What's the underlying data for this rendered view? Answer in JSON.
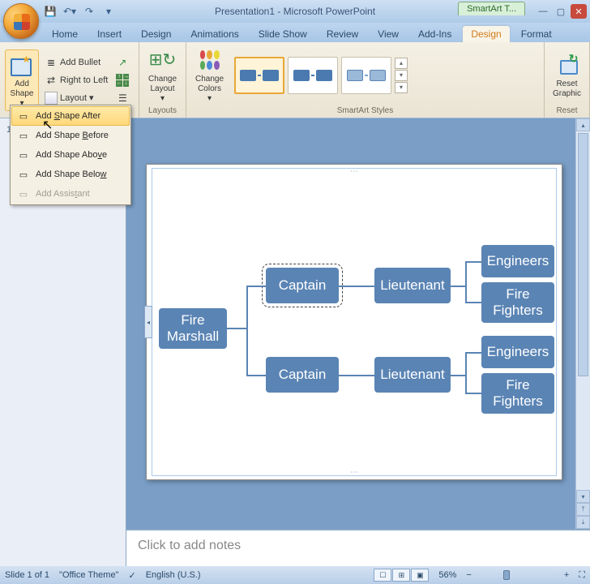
{
  "app_title": "Presentation1 - Microsoft PowerPoint",
  "contextual_tab": "SmartArt T...",
  "qat_icons": [
    "save-icon",
    "undo-icon",
    "redo-icon",
    "qat-more-icon"
  ],
  "tabs": {
    "items": [
      "Home",
      "Insert",
      "Design",
      "Animations",
      "Slide Show",
      "Review",
      "View",
      "Add-Ins",
      "Design",
      "Format"
    ],
    "active_index": 8
  },
  "ribbon": {
    "create_graphic": {
      "add_shape": "Add\nShape",
      "add_bullet": "Add Bullet",
      "right_to_left": "Right to Left",
      "layout": "Layout"
    },
    "layouts_label": "Layouts",
    "change_layout": "Change\nLayout",
    "change_colors": "Change\nColors",
    "styles_label": "SmartArt Styles",
    "reset_graphic": "Reset\nGraphic",
    "reset_label": "Reset"
  },
  "dropdown": {
    "items": [
      {
        "label_pre": "Add ",
        "ul": "S",
        "label_post": "hape After",
        "hover": true
      },
      {
        "label_pre": "Add Shape ",
        "ul": "B",
        "label_post": "efore"
      },
      {
        "label_pre": "Add Shape Abo",
        "ul": "v",
        "label_post": "e"
      },
      {
        "label_pre": "Add Shape Belo",
        "ul": "w",
        "label_post": ""
      },
      {
        "label_pre": "Add Assis",
        "ul": "t",
        "label_post": "ant",
        "disabled": true
      }
    ]
  },
  "chart_data": {
    "type": "hierarchy",
    "title": "",
    "selected_node": "Captain (top)",
    "nodes": [
      {
        "id": "root",
        "label": "Fire\nMarshall"
      },
      {
        "id": "c1",
        "label": "Captain",
        "parent": "root"
      },
      {
        "id": "c2",
        "label": "Captain",
        "parent": "root"
      },
      {
        "id": "l1",
        "label": "Lieutenant",
        "parent": "c1"
      },
      {
        "id": "l2",
        "label": "Lieutenant",
        "parent": "c2"
      },
      {
        "id": "e1",
        "label": "Engineers",
        "parent": "l1"
      },
      {
        "id": "f1",
        "label": "Fire\nFighters",
        "parent": "l1"
      },
      {
        "id": "e2",
        "label": "Engineers",
        "parent": "l2"
      },
      {
        "id": "f2",
        "label": "Fire\nFighters",
        "parent": "l2"
      }
    ]
  },
  "notes_placeholder": "Click to add notes",
  "status": {
    "slide": "Slide 1 of 1",
    "theme": "\"Office Theme\"",
    "lang": "English (U.S.)",
    "zoom": "56%"
  }
}
